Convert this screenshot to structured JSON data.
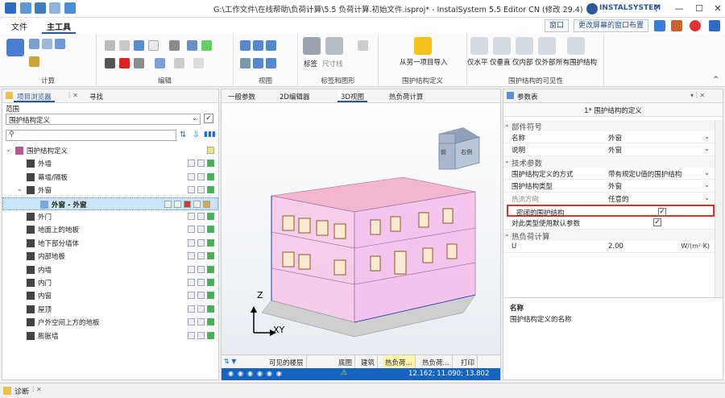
{
  "window": {
    "title": "G:\\工作文件\\在线帮助\\负荷计算\\5.5 负荷计算.初始文件.isproj* - InstalSystem 5.5 Editor CN (修改 29.4)",
    "brand": "INSTALSYSTEM",
    "controls": {
      "help": "?",
      "minimize": "—",
      "maximize": "☐",
      "close": "✕"
    }
  },
  "menu": {
    "items": [
      "文件",
      "主工具"
    ],
    "active": "主工具",
    "window_label": "窗口",
    "layout_label": "更改屏幕的窗口布置"
  },
  "ribbon": {
    "groups": [
      "计算",
      "编辑",
      "视图",
      "标签和图形",
      "围护结构定义",
      "围护结构的可见性"
    ],
    "labels_buttons": [
      "标签",
      "尺寸线"
    ],
    "import_label": "从另一项目导入",
    "visibility_buttons": [
      "仅水平",
      "仅垂直",
      "仅内部",
      "仅外部",
      "所有围护结构"
    ]
  },
  "left_panel": {
    "tabs": [
      "项目浏览器",
      "寻找"
    ],
    "scope_label": "范围",
    "scope_value": "围护结构定义",
    "tree": [
      {
        "label": "围护结构定义",
        "level": 0,
        "icon": "folder-icon"
      },
      {
        "label": "外墙",
        "level": 1
      },
      {
        "label": "幕墙/隔板",
        "level": 1
      },
      {
        "label": "外窗",
        "level": 1
      },
      {
        "label": "外窗 - 外窗",
        "level": 2,
        "selected": true
      },
      {
        "label": "外门",
        "level": 1
      },
      {
        "label": "地面上的地板",
        "level": 1
      },
      {
        "label": "地下部分墙体",
        "level": 1
      },
      {
        "label": "内部地板",
        "level": 1
      },
      {
        "label": "内墙",
        "level": 1
      },
      {
        "label": "内门",
        "level": 1
      },
      {
        "label": "内窗",
        "level": 1
      },
      {
        "label": "屋顶",
        "level": 1
      },
      {
        "label": "户外空间上方的地板",
        "level": 1
      },
      {
        "label": "膨胀墙",
        "level": 1
      }
    ]
  },
  "center": {
    "tabs": [
      "一般参数",
      "2D编辑器",
      "3D视图",
      "热负荷计算"
    ],
    "active_tab": "3D视图",
    "axes": {
      "z": "Z",
      "xy": "XY"
    },
    "cube_faces": [
      "前",
      "右侧"
    ],
    "bottom_tabs": [
      "可见的楼层",
      "底图",
      "建筑",
      "热负荷...",
      "热负荷...",
      "打印"
    ],
    "coords": "12.162; 11.090; 13.802"
  },
  "right_panel": {
    "title": "参数表",
    "subtitle": "1* 围护结构的定义",
    "sections": [
      {
        "name": "部件符号",
        "rows": [
          {
            "key": "名称",
            "value": "外窗",
            "dropdown": true
          },
          {
            "key": "说明",
            "value": "外窗",
            "dropdown": true
          }
        ]
      },
      {
        "name": "技术参数",
        "rows": [
          {
            "key": "围护结构定义的方式",
            "value": "带有规定U值的围护结构",
            "dropdown": true
          },
          {
            "key": "围护结构类型",
            "value": "外窗",
            "dropdown": true
          },
          {
            "key": "热流方向",
            "value": "任意的",
            "dropdown": true,
            "disabled": true
          },
          {
            "key": "密闭的围护结构",
            "value": "✓",
            "checkbox": true,
            "highlight": true
          },
          {
            "key": "对此类型使用默认参数",
            "value": "✓",
            "checkbox": true
          }
        ]
      },
      {
        "name": "热负荷计算",
        "rows": [
          {
            "key": "U",
            "value": "2.00",
            "unit": "W/(m²·K)"
          }
        ]
      }
    ],
    "desc_title": "名称",
    "desc_text": "围护结构定义的名称"
  },
  "statusbar": {
    "diag_label": "诊断"
  },
  "colors": {
    "accent": "#2b579a",
    "highlight": "#e0322b",
    "selection": "#cce4f7",
    "statusbar": "#1565c0"
  }
}
